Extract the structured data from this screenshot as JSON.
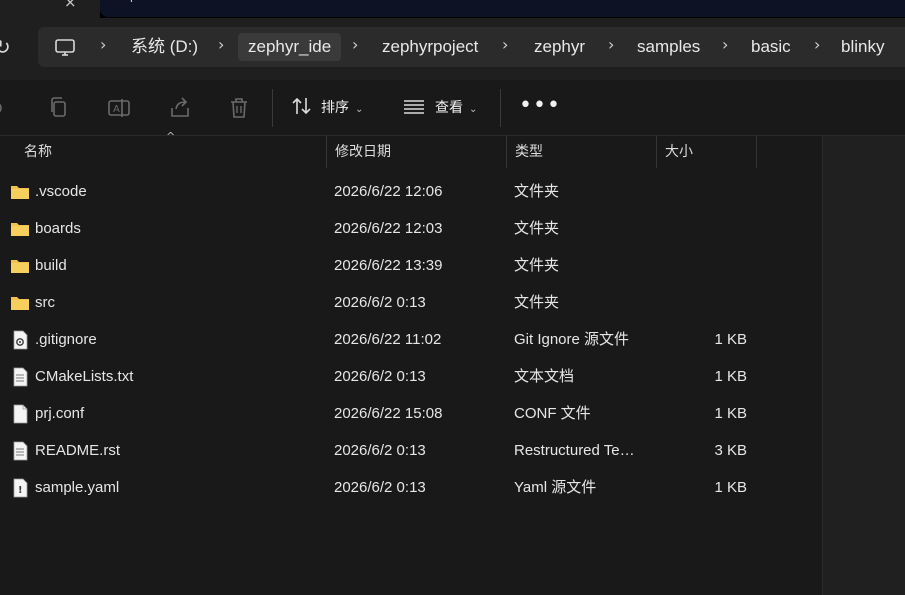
{
  "tabs": {
    "close_glyph": "×",
    "next_label": "+"
  },
  "address": {
    "root_icon": "computer-icon",
    "crumbs": [
      {
        "label": "系统 (D:)"
      },
      {
        "label": "zephyr_ide"
      },
      {
        "label": "zephyrpoject"
      },
      {
        "label": "zephyr"
      },
      {
        "label": "samples"
      },
      {
        "label": "basic"
      },
      {
        "label": "blinky"
      }
    ]
  },
  "toolbar": {
    "sort_label": "排序",
    "view_label": "查看",
    "more_label": "•••"
  },
  "columns": {
    "name": "名称",
    "modified": "修改日期",
    "type": "类型",
    "size": "大小"
  },
  "files": [
    {
      "icon": "folder-icon",
      "name": ".vscode",
      "modified": "2026/6/22 12:06",
      "type": "文件夹",
      "size": ""
    },
    {
      "icon": "folder-icon",
      "name": "boards",
      "modified": "2026/6/22 12:03",
      "type": "文件夹",
      "size": ""
    },
    {
      "icon": "folder-icon",
      "name": "build",
      "modified": "2026/6/22 13:39",
      "type": "文件夹",
      "size": ""
    },
    {
      "icon": "folder-icon",
      "name": "src",
      "modified": "2026/6/2 0:13",
      "type": "文件夹",
      "size": ""
    },
    {
      "icon": "settings-file-icon",
      "name": ".gitignore",
      "modified": "2026/6/22 11:02",
      "type": "Git Ignore 源文件",
      "size": "1 KB"
    },
    {
      "icon": "text-file-icon",
      "name": "CMakeLists.txt",
      "modified": "2026/6/2 0:13",
      "type": "文本文档",
      "size": "1 KB"
    },
    {
      "icon": "file-icon",
      "name": "prj.conf",
      "modified": "2026/6/22 15:08",
      "type": "CONF 文件",
      "size": "1 KB"
    },
    {
      "icon": "text-file-icon",
      "name": "README.rst",
      "modified": "2026/6/2 0:13",
      "type": "Restructured Te…",
      "size": "3 KB"
    },
    {
      "icon": "yaml-file-icon",
      "name": "sample.yaml",
      "modified": "2026/6/2 0:13",
      "type": "Yaml 源文件",
      "size": "1 KB"
    }
  ],
  "colors": {
    "background": "#191919",
    "folder": "#f2c14e",
    "address_bg": "#2b2b2b"
  }
}
